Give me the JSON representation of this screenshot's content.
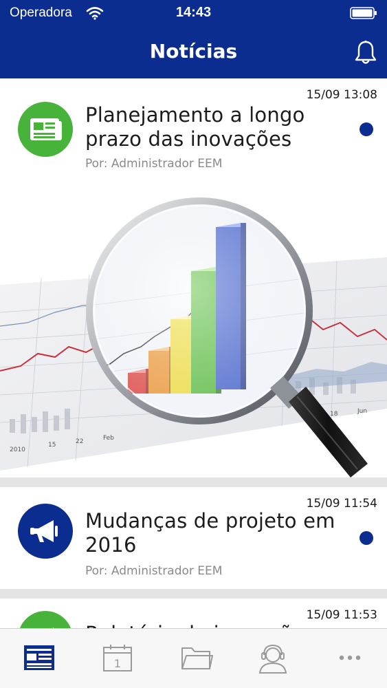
{
  "status_bar": {
    "carrier": "Operadora",
    "time": "14:43"
  },
  "nav": {
    "title": "Notícias"
  },
  "news": [
    {
      "date": "15/09 13:08",
      "title": "Planejamento a longo prazo das inovações",
      "author": "Por: Administrador EEM",
      "icon": "newspaper-icon",
      "icon_color": "#48b33a",
      "unread": true,
      "has_image": true
    },
    {
      "date": "15/09 11:54",
      "title": "Mudanças de projeto em 2016",
      "author": "Por: Administrador EEM",
      "icon": "megaphone-icon",
      "icon_color": "#0b2d8f",
      "unread": true,
      "has_image": false
    },
    {
      "date": "15/09 11:53",
      "title": "Relatório de inovações",
      "author": "",
      "icon": "megaphone-icon",
      "icon_color": "#48b33a",
      "unread": false,
      "has_image": false
    }
  ],
  "tabs": [
    {
      "icon": "news-icon",
      "active": true
    },
    {
      "icon": "calendar-icon",
      "active": false,
      "badge_text": "1"
    },
    {
      "icon": "folder-icon",
      "active": false
    },
    {
      "icon": "support-icon",
      "active": false
    },
    {
      "icon": "more-icon",
      "active": false
    }
  ],
  "colors": {
    "brand": "#0b2d8f",
    "green": "#48b33a",
    "tab_inactive": "#9a9a9a"
  }
}
